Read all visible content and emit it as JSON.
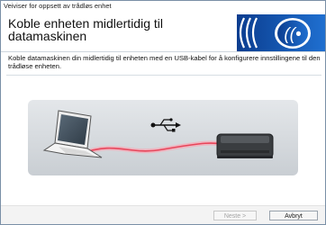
{
  "window": {
    "title": "Veiviser for oppsett av trådløs enhet"
  },
  "header": {
    "heading_line1": "Koble enheten midlertidig til",
    "heading_line2": "datamaskinen",
    "logo_icon": "wifi-icon"
  },
  "content": {
    "description": "Koble datamaskinen din midlertidig til enheten med en USB-kabel for å konfigurere innstillingene til den trådløse enheten."
  },
  "illustration": {
    "icons": [
      "laptop-icon",
      "usb-icon",
      "printer-icon"
    ],
    "cable_color": "#e8455a"
  },
  "buttons": {
    "next": "Neste >",
    "cancel": "Avbryt"
  },
  "colors": {
    "brand_blue": "#0a4aa0",
    "panel_bg": "#d9dde1"
  }
}
